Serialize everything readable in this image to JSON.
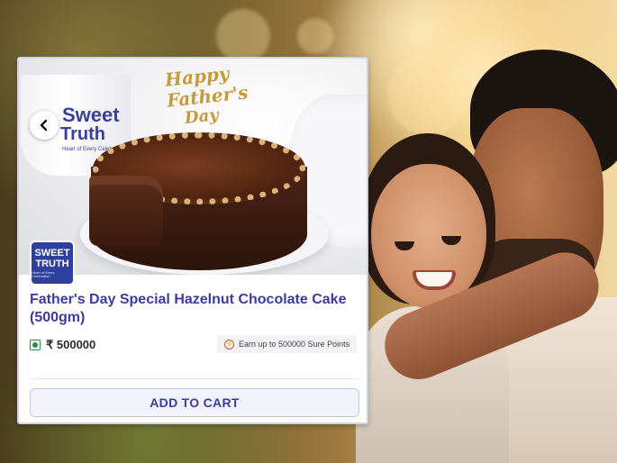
{
  "product": {
    "title": "Father's Day Special Hazelnut Chocolate Cake (500gm)",
    "price": "₹ 500000",
    "points_text": "Earn up to 500000 Sure Points"
  },
  "brand": {
    "name_line1": "Sweet",
    "name_line2": "Truth",
    "tagline": "Heart of Every Celebration",
    "badge_line1": "SWEET",
    "badge_line2": "TRUTH",
    "badge_tagline": "Heart of Every Celebration"
  },
  "cake_topper": {
    "line1": "Happy",
    "line2": "Father's",
    "line3": "Day"
  },
  "actions": {
    "add_to_cart": "ADD TO CART"
  },
  "icons": {
    "back": "chevron-left-icon",
    "veg": "veg-indicator-icon",
    "points": "sure-points-icon"
  },
  "colors": {
    "accent": "#3d3c9c",
    "brand_badge": "#2f3f9e",
    "veg_green": "#2e8b3d",
    "points_red": "#d54a3c"
  }
}
